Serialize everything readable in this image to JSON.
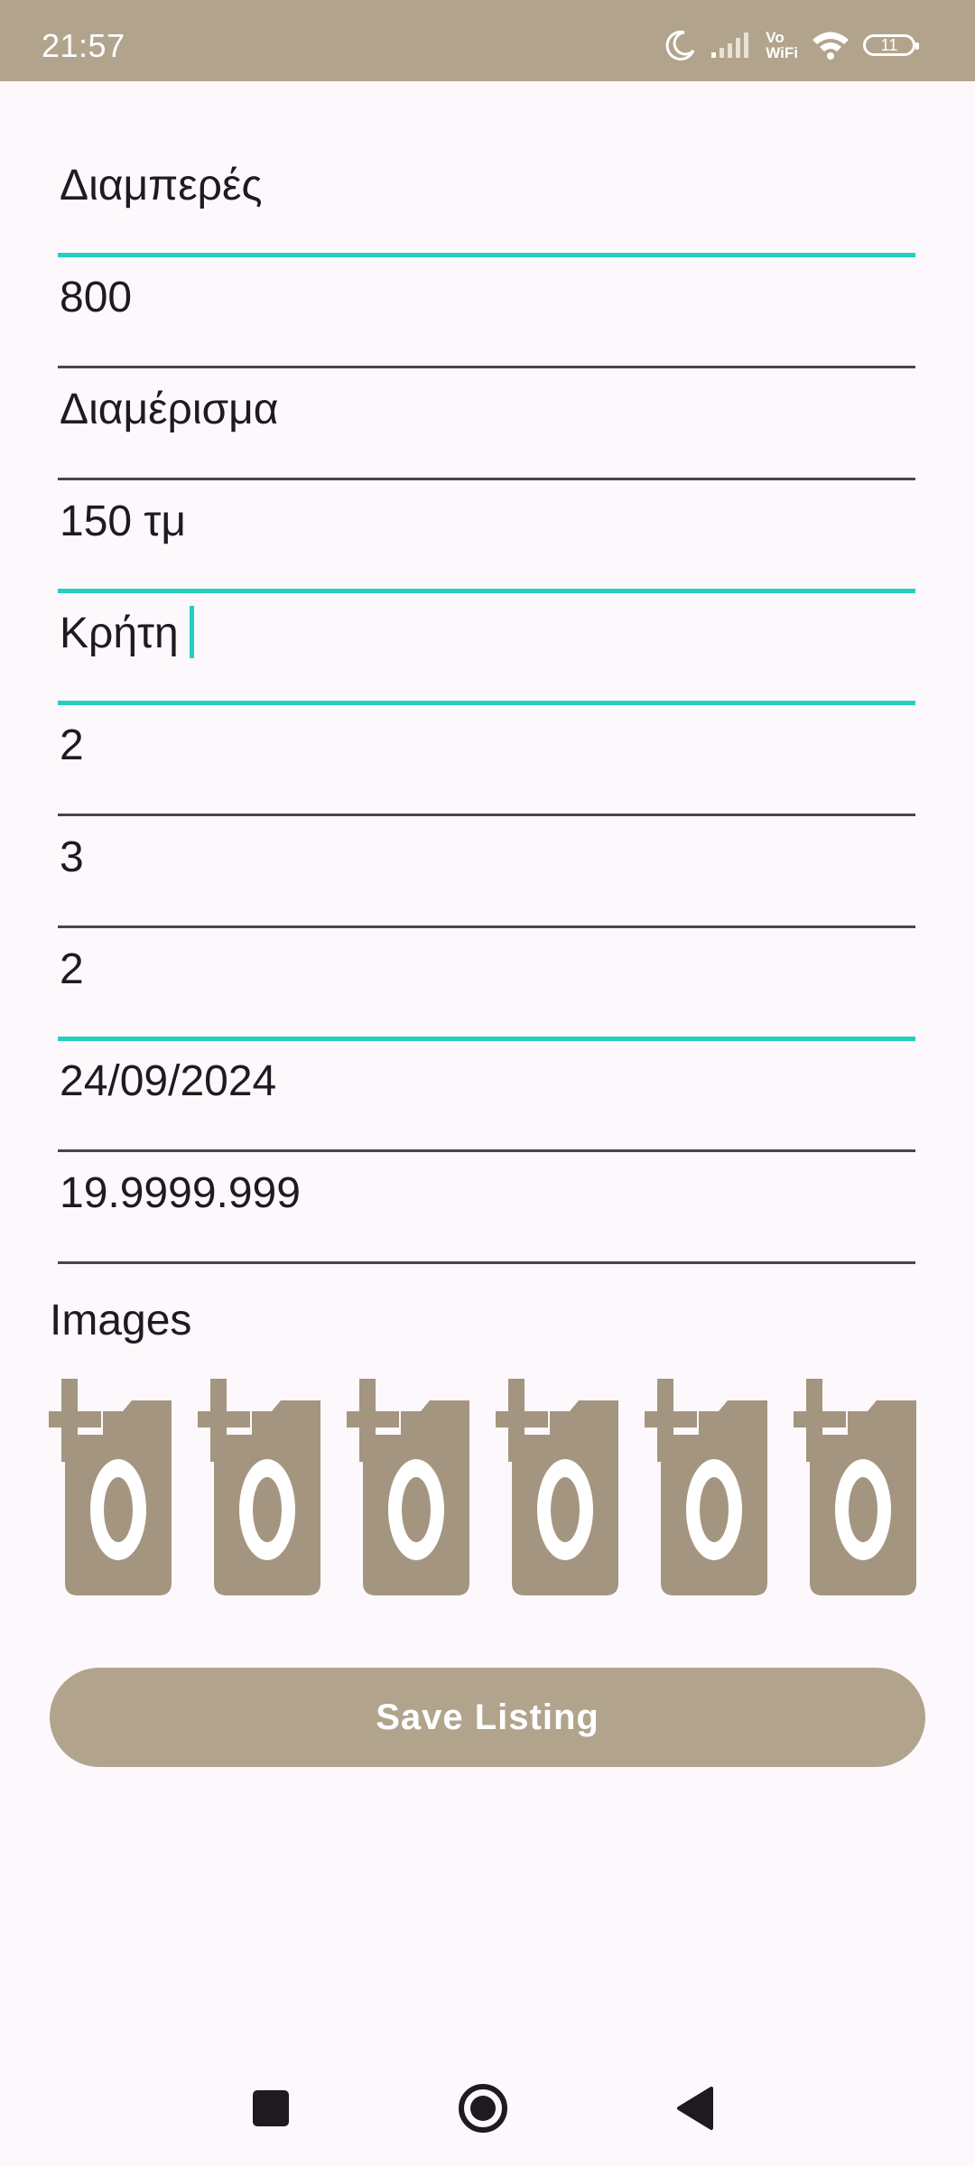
{
  "status_bar": {
    "time": "21:57",
    "volte_line1": "Vo",
    "volte_line2": "WiFi",
    "battery": "11",
    "icons": [
      "moon-icon",
      "signal-icon",
      "wifi-icon",
      "battery-icon"
    ]
  },
  "form": {
    "fields": [
      {
        "value": "Διαμπερές",
        "focused": true
      },
      {
        "value": "800",
        "focused": false
      },
      {
        "value": "Διαμέρισμα",
        "focused": false
      },
      {
        "value": "150 τμ",
        "focused": true
      },
      {
        "value": "Κρήτη",
        "focused": true,
        "has_cursor": true
      },
      {
        "value": "2",
        "focused": false
      },
      {
        "value": "3",
        "focused": false
      },
      {
        "value": "2",
        "focused": true
      },
      {
        "value": "24/09/2024",
        "focused": false
      },
      {
        "value": "19.9999.999",
        "focused": false
      }
    ]
  },
  "images": {
    "label": "Images",
    "slots": [
      "add-photo-icon",
      "add-photo-icon",
      "add-photo-icon",
      "add-photo-icon",
      "add-photo-icon",
      "add-photo-icon"
    ]
  },
  "save_button": {
    "label": "Save Listing"
  },
  "nav_bar": {
    "icons": [
      "recents-icon",
      "home-icon",
      "back-icon"
    ]
  },
  "colors": {
    "accent": "#b2a48c",
    "focus_line": "#24cfc0",
    "background": "#fdf8fb",
    "icon": "#a39580"
  }
}
